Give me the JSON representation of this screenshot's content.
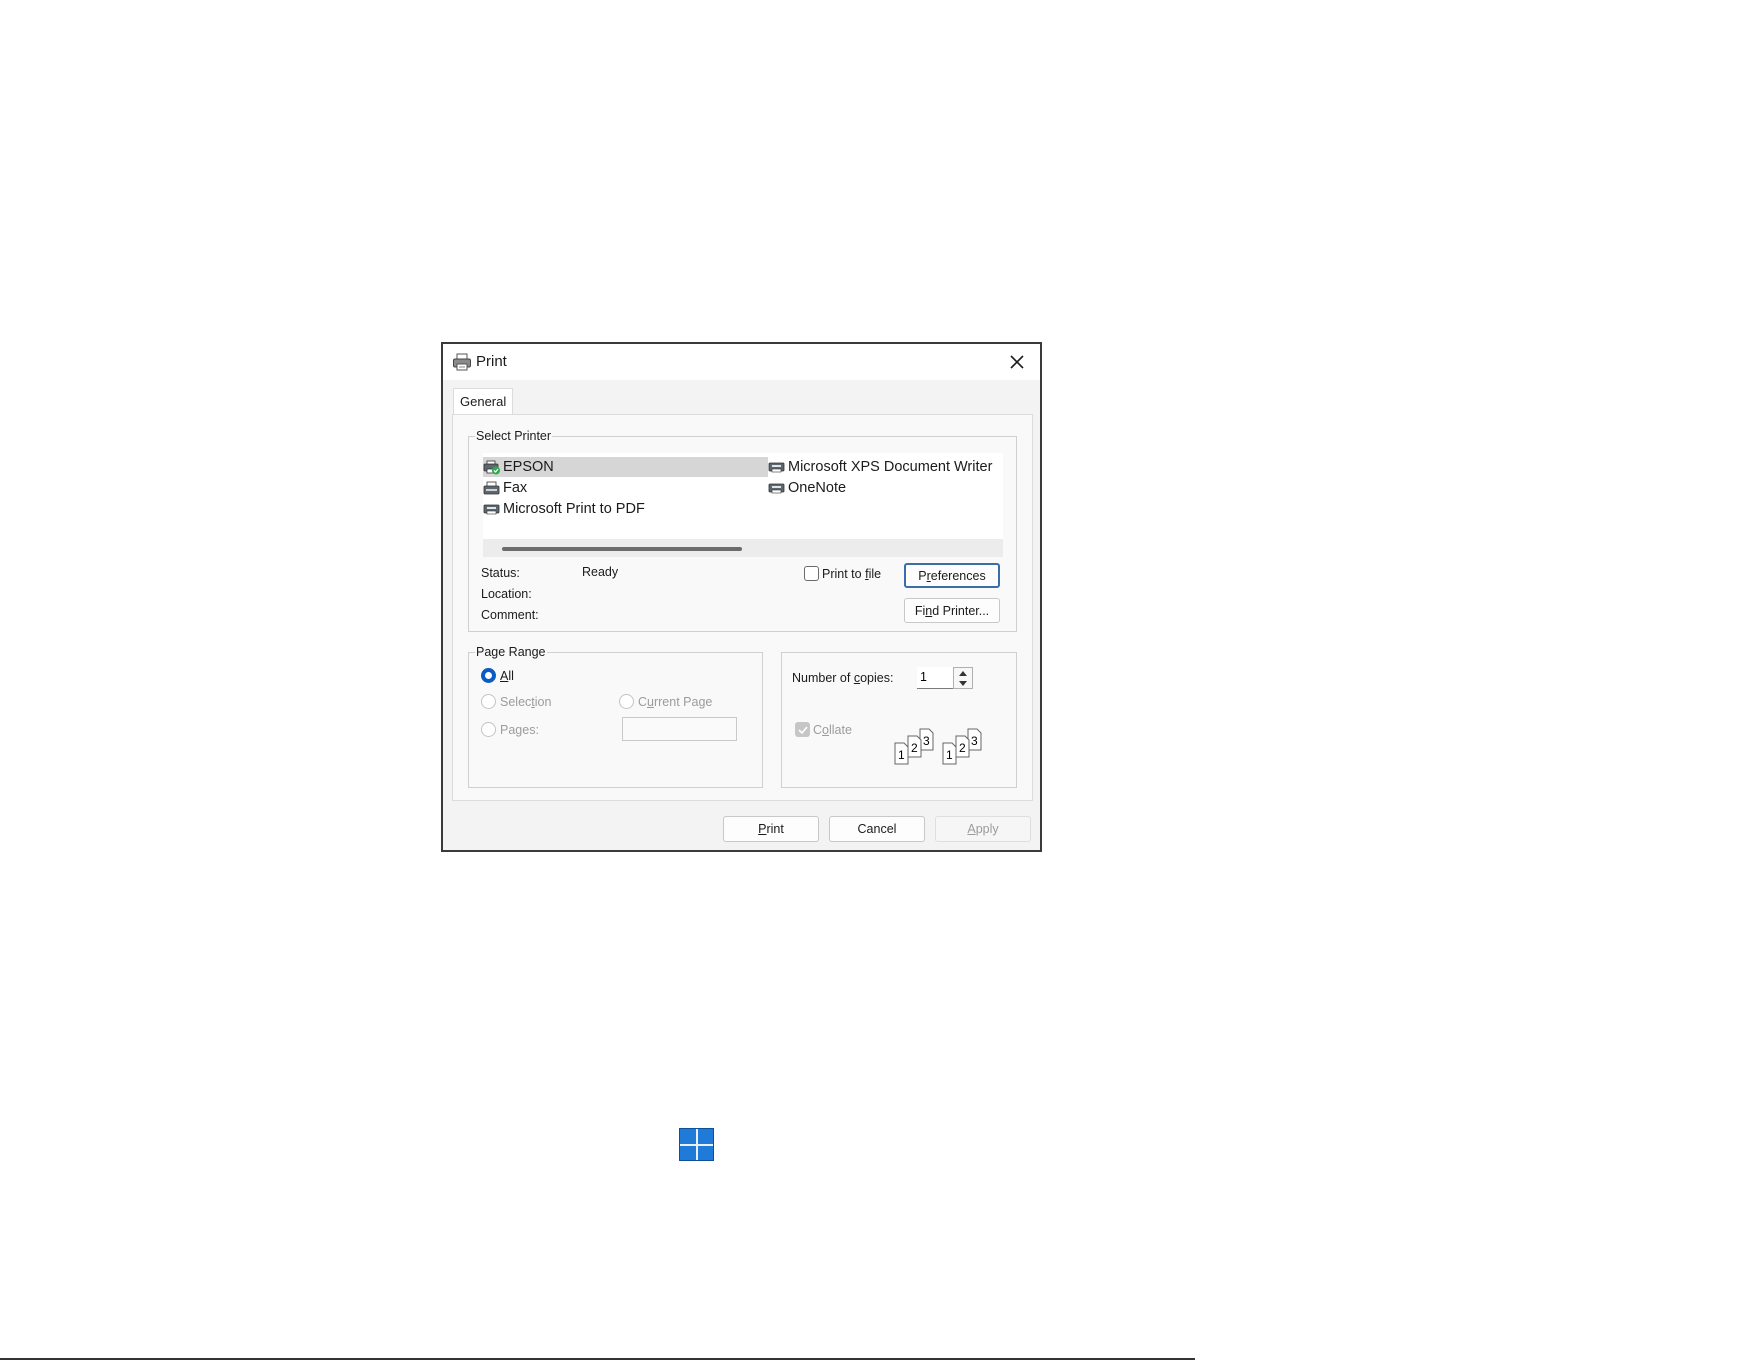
{
  "dialog": {
    "title": "Print",
    "close_label": "×",
    "tab_label": "General"
  },
  "select_printer": {
    "group_label": "Select Printer",
    "printers": [
      {
        "name": "EPSON",
        "icon": "printer-default-icon",
        "selected": true
      },
      {
        "name": "Fax",
        "icon": "fax-icon",
        "selected": false
      },
      {
        "name": "Microsoft Print to PDF",
        "icon": "printer-icon",
        "selected": false
      },
      {
        "name": "Microsoft XPS Document Writer",
        "icon": "printer-icon",
        "selected": false
      },
      {
        "name": "OneNote",
        "icon": "printer-icon",
        "selected": false
      }
    ],
    "status_label": "Status:",
    "status_value": "Ready",
    "location_label": "Location:",
    "comment_label": "Comment:",
    "print_to_file": {
      "label_prefix": "Print to ",
      "label_accel": "f",
      "label_suffix": "ile",
      "checked": false
    },
    "preferences_button": {
      "accel": "r",
      "pre": "P",
      "post": "eferences"
    },
    "find_printer_button": {
      "pre": "Fi",
      "accel": "n",
      "post": "d Printer..."
    }
  },
  "page_range": {
    "group_label": "Page Range",
    "options": {
      "all": {
        "pre": "",
        "accel": "l",
        "lead": "A",
        "post": "l",
        "checked": true
      },
      "selection": {
        "lead": "Selec",
        "accel": "t",
        "post": "ion",
        "enabled": false
      },
      "current_page": {
        "lead": "C",
        "accel": "u",
        "post": "rrent Page",
        "enabled": false
      },
      "pages": {
        "lead": "Pa",
        "accel": "g",
        "post": "es:",
        "enabled": false
      }
    }
  },
  "copies": {
    "label_pre": "Number of ",
    "label_accel": "c",
    "label_post": "opies:",
    "value": "1",
    "collate": {
      "lead": "C",
      "accel": "o",
      "post": "llate",
      "checked": true,
      "enabled": false
    },
    "collate_digits": [
      "1",
      "2",
      "3",
      "1",
      "2",
      "3"
    ]
  },
  "footer": {
    "print_accel": "P",
    "print_post": "rint",
    "cancel": "Cancel",
    "apply_accel": "A",
    "apply_post": "pply"
  },
  "colors": {
    "accent": "#0a5bc4",
    "selection": "#d6d6d6",
    "focus_border": "#3b6ea8"
  }
}
